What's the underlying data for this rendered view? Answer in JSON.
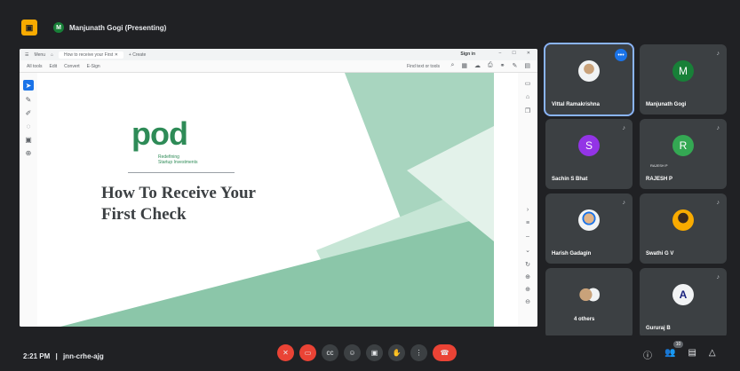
{
  "meeting": {
    "presenting_chip": "Manjunath Gogi (Presenting)",
    "presenter_initial": "M",
    "time": "2:21 PM",
    "separator": "|",
    "code": "jnn-crhe-ajg",
    "people_count": "10"
  },
  "browser": {
    "menu_label": "Menu",
    "tab_title": "How to receive your First",
    "new_tab": "+ Create",
    "sign_in": "Sign in",
    "toolbar_items": [
      "All tools",
      "Edit",
      "Convert",
      "E-Sign"
    ],
    "find_text": "Find text or tools"
  },
  "slide": {
    "logo": "pod",
    "tagline_line1": "Redefining",
    "tagline_line2": "Startup Investments",
    "title_line1": "How To Receive Your",
    "title_line2": "First Check"
  },
  "participants": [
    {
      "name": "Vittal Ramakrishna",
      "initial": "",
      "color": "#f1f3f4",
      "kind": "photo"
    },
    {
      "name": "Manjunath Gogi",
      "initial": "M",
      "color": "#188038",
      "kind": "letter"
    },
    {
      "name": "Sachin S Bhat",
      "initial": "S",
      "color": "#9334e6",
      "kind": "letter"
    },
    {
      "name": "RAJESH P",
      "initial": "R",
      "color": "#34a853",
      "kind": "letter",
      "subname": "RAJESH P"
    },
    {
      "name": "Harish Gadagin",
      "initial": "",
      "color": "#f1f3f4",
      "kind": "photo"
    },
    {
      "name": "Swathi G V",
      "initial": "",
      "color": "#f9ab00",
      "kind": "photo"
    },
    {
      "name": "4 others",
      "initial": "",
      "color": "#f1f3f4",
      "kind": "group"
    },
    {
      "name": "Gururaj B",
      "initial": "A",
      "color": "#f1f3f4",
      "kind": "logo"
    }
  ],
  "colors": {
    "accent": "#1a73e8",
    "danger": "#ea4335",
    "slide_green": "#2e8b57"
  }
}
